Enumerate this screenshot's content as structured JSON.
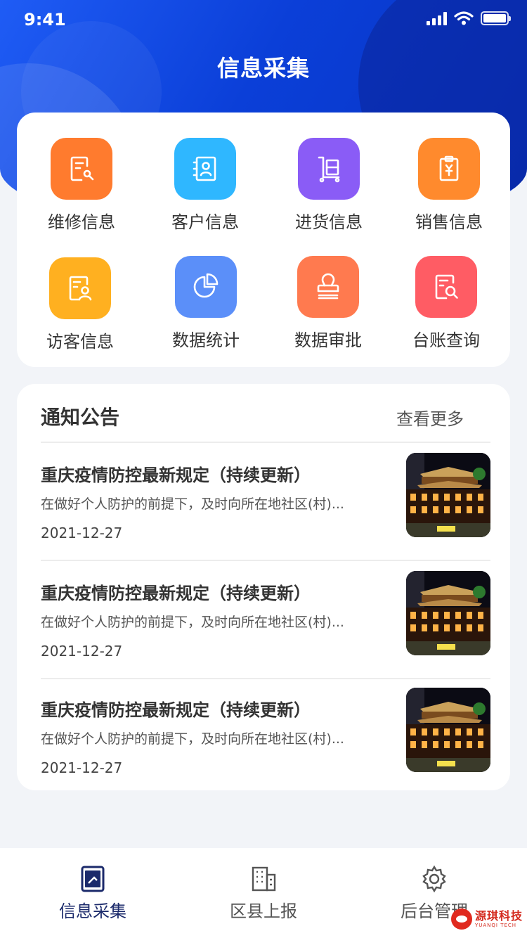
{
  "status_bar": {
    "time": "9:41"
  },
  "header": {
    "title": "信息采集"
  },
  "features": [
    {
      "label": "维修信息",
      "icon": "repair-doc-icon",
      "color": "#ff7b2e"
    },
    {
      "label": "客户信息",
      "icon": "customer-card-icon",
      "color": "#2fb7ff"
    },
    {
      "label": "进货信息",
      "icon": "cart-icon",
      "color": "#8a5cf6"
    },
    {
      "label": "销售信息",
      "icon": "sales-clipboard-icon",
      "color": "#ff8a2d"
    },
    {
      "label": "访客信息",
      "icon": "visitor-doc-icon",
      "color": "#ffb020"
    },
    {
      "label": "数据统计",
      "icon": "pie-chart-icon",
      "color": "#5b8ff9"
    },
    {
      "label": "数据审批",
      "icon": "approval-stamp-icon",
      "color": "#ff7a4f"
    },
    {
      "label": "台账查询",
      "icon": "ledger-search-icon",
      "color": "#ff5c64"
    }
  ],
  "notice": {
    "title": "通知公告",
    "more": "查看更多",
    "items": [
      {
        "title": "重庆疫情防控最新规定（持续更新）",
        "summary": "在做好个人防护的前提下，及时向所在地社区(村)...",
        "date": "2021-12-27"
      },
      {
        "title": "重庆疫情防控最新规定（持续更新）",
        "summary": "在做好个人防护的前提下，及时向所在地社区(村)...",
        "date": "2021-12-27"
      },
      {
        "title": "重庆疫情防控最新规定（持续更新）",
        "summary": "在做好个人防护的前提下，及时向所在地社区(村)...",
        "date": "2021-12-27"
      }
    ]
  },
  "tabbar": {
    "items": [
      {
        "label": "信息采集",
        "icon": "info-collect-icon",
        "active": true
      },
      {
        "label": "区县上报",
        "icon": "building-icon",
        "active": false
      },
      {
        "label": "后台管理",
        "icon": "gear-icon",
        "active": false
      }
    ],
    "active_color": "#1b2a6b",
    "inactive_color": "#555555"
  },
  "watermark": {
    "name": "源琪科技",
    "sub": "YUANQI TECH"
  }
}
